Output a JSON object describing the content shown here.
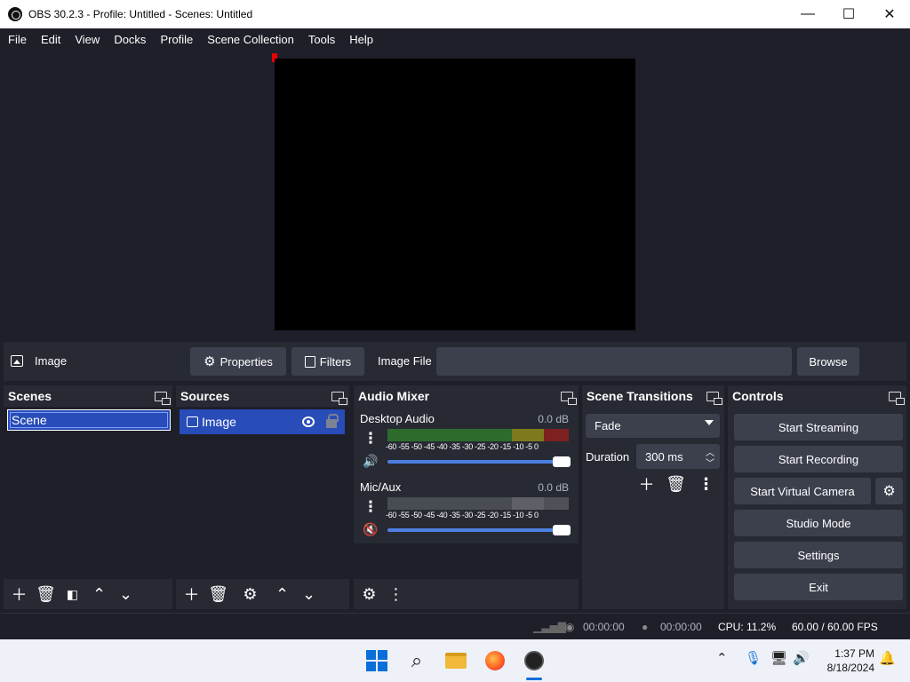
{
  "window": {
    "title": "OBS 30.2.3 - Profile: Untitled - Scenes: Untitled",
    "minimize": "—",
    "maximize": "☐",
    "close": "✕"
  },
  "menu": [
    "File",
    "Edit",
    "View",
    "Docks",
    "Profile",
    "Scene Collection",
    "Tools",
    "Help"
  ],
  "source_toolbar": {
    "source_name": "Image",
    "properties_label": "Properties",
    "filters_label": "Filters",
    "image_file_label": "Image File",
    "image_file_value": "",
    "browse_label": "Browse"
  },
  "scenes_dock": {
    "title": "Scenes",
    "items": [
      "Scene"
    ]
  },
  "sources_dock": {
    "title": "Sources",
    "items": [
      "Image"
    ]
  },
  "audio_mixer": {
    "title": "Audio Mixer",
    "channels": [
      {
        "name": "Desktop Audio",
        "db": "0.0 dB",
        "muted": false,
        "volume": 1.0
      },
      {
        "name": "Mic/Aux",
        "db": "0.0 dB",
        "muted": true,
        "volume": 1.0
      }
    ],
    "ticks": "-60 -55 -50 -45 -40 -35 -30 -25 -20 -15 -10 -5 0"
  },
  "scene_transitions": {
    "title": "Scene Transitions",
    "transition": "Fade",
    "duration_label": "Duration",
    "duration_value": "300 ms"
  },
  "controls": {
    "title": "Controls",
    "start_streaming": "Start Streaming",
    "start_recording": "Start Recording",
    "start_virtual_camera": "Start Virtual Camera",
    "studio_mode": "Studio Mode",
    "settings": "Settings",
    "exit": "Exit"
  },
  "status": {
    "stream_time": "00:00:00",
    "record_time": "00:00:00",
    "cpu": "CPU: 11.2%",
    "fps": "60.00 / 60.00 FPS"
  },
  "taskbar": {
    "time": "1:37 PM",
    "date": "8/18/2024"
  }
}
